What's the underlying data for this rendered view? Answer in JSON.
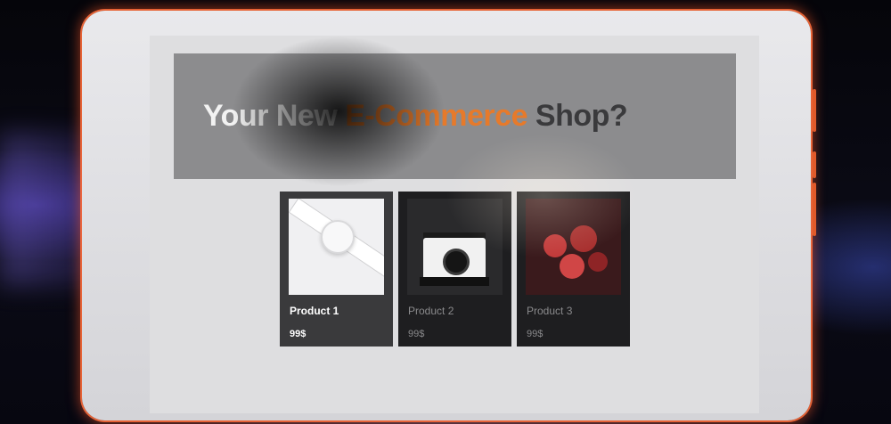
{
  "hero": {
    "title_part1": "Your New ",
    "title_accent": "E-Commerce",
    "title_part2": " Shop?"
  },
  "products": [
    {
      "name": "Product 1",
      "price": "99$",
      "image": "smartwatch"
    },
    {
      "name": "Product 2",
      "price": "99$",
      "image": "instant-camera"
    },
    {
      "name": "Product 3",
      "price": "99$",
      "image": "berries"
    }
  ],
  "colors": {
    "accent": "#e67a2b",
    "frame_glow": "#ff6e3c",
    "card_bg": "#3a3a3c",
    "hero_bg": "#8c8c8e"
  }
}
